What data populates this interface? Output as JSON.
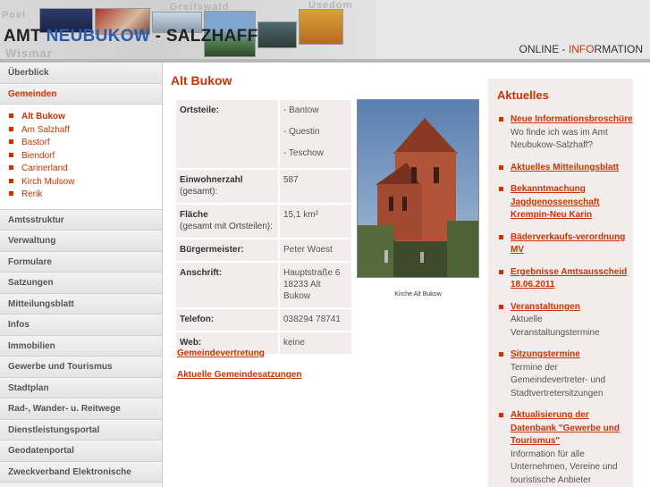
{
  "header": {
    "title_part1": "AMT ",
    "title_part2": "NEUBUKOW",
    "title_part3": " - SALZHAFF",
    "map_labels": [
      "Poel",
      "Greifswald",
      "Usedom",
      "Wismar"
    ],
    "online_part1": "ONLINE - ",
    "online_part2": "INFO",
    "online_part3": "RMATION"
  },
  "sidebar": {
    "top": [
      {
        "label": "Überblick"
      },
      {
        "label": "Gemeinden"
      }
    ],
    "sub": [
      {
        "label": "Alt Bukow"
      },
      {
        "label": "Am Salzhaff"
      },
      {
        "label": "Bastorf"
      },
      {
        "label": "Biendorf"
      },
      {
        "label": "Carinerland"
      },
      {
        "label": "Kirch Mulsow"
      },
      {
        "label": "Rerik"
      }
    ],
    "items": [
      {
        "label": "Amtsstruktur"
      },
      {
        "label": "Verwaltung"
      },
      {
        "label": "Formulare"
      },
      {
        "label": "Satzungen"
      },
      {
        "label": "Mitteilungsblatt"
      },
      {
        "label": "Infos"
      },
      {
        "label": "Immobilien"
      },
      {
        "label": "Gewerbe und Tourismus"
      },
      {
        "label": "Stadtplan"
      },
      {
        "label": "Rad-, Wander- u. Reitwege"
      },
      {
        "label": "Dienstleistungsportal"
      },
      {
        "label": "Geodatenportal"
      },
      {
        "label": "Zweckverband Elektronische"
      }
    ]
  },
  "main": {
    "title": "Alt Bukow",
    "rows": {
      "ortsteile": {
        "key": "Ortsteile:",
        "values": [
          "- Bantow",
          "- Questin",
          "- Teschow"
        ]
      },
      "einwohner": {
        "key": "Einwohnerzahl",
        "key_sub": "(gesamt):",
        "value": "587"
      },
      "flaeche": {
        "key": "Fläche",
        "key_sub": "(gesamt mit Ortsteilen):",
        "value": "15,1 km²"
      },
      "buergermeister": {
        "key": "Bürgermeister:",
        "value": "Peter Woest"
      },
      "anschrift": {
        "key": "Anschrift:",
        "value_line1": "Hauptstraße 6",
        "value_line2": "18233 Alt Bukow"
      },
      "telefon": {
        "key": "Telefon:",
        "value": "038294 78741"
      },
      "web": {
        "key": "Web:",
        "value": "keine"
      }
    },
    "link_gemeindevertretung": "Gemeindevertretung",
    "link_satzungen": "Aktuelle Gemeindesatzungen",
    "image_caption": "Kirche Alt Bukow"
  },
  "aktuelles": {
    "title": "Aktuelles",
    "items": [
      {
        "title": "Neue Informationsbroschüre",
        "desc": "Wo finde ich was im Amt Neubukow-Salzhaff?"
      },
      {
        "title": "Aktuelles Mitteilungsblatt",
        "desc": ""
      },
      {
        "title": "Bekanntmachung Jagdgenossenschaft Krempin-Neu Karin",
        "desc": ""
      },
      {
        "title": "Bäderverkaufs-verordnung MV",
        "desc": ""
      },
      {
        "title": "Ergebnisse Amtsausscheid 18.06.2011",
        "desc": ""
      },
      {
        "title": "Veranstaltungen",
        "desc": "Aktuelle Veranstaltungstermine"
      },
      {
        "title": "Sitzungstermine",
        "desc": "Termine der Gemeindevertreter- und Stadtvertretersitzungen"
      },
      {
        "title": "Aktualisierung der Datenbank \"Gewerbe und Tourismus\"",
        "desc": "Information für alle Unternehmen, Vereine und touristische Anbieter"
      }
    ]
  },
  "colors": {
    "accent": "#cc3300",
    "title_blue": "#2a5db0",
    "panel_bg": "#f3ecec"
  }
}
